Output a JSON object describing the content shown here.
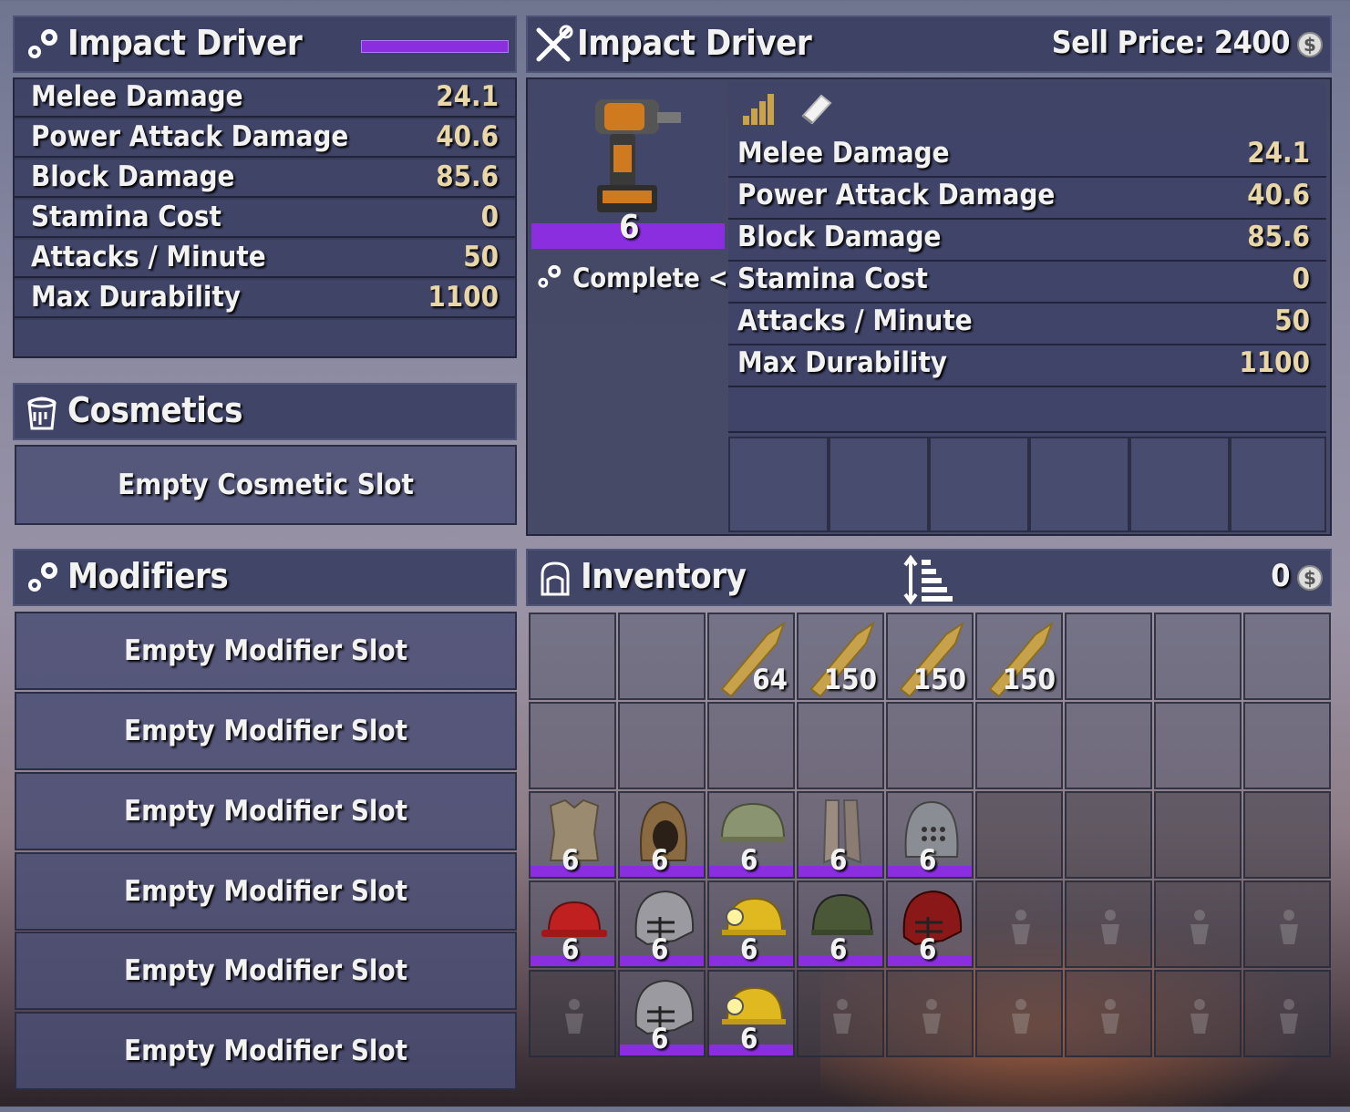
{
  "left_item": {
    "title": "Impact Driver",
    "stats": [
      {
        "label": "Melee Damage",
        "value": "24.1"
      },
      {
        "label": "Power Attack Damage",
        "value": "40.6"
      },
      {
        "label": "Block Damage",
        "value": "85.6"
      },
      {
        "label": "Stamina Cost",
        "value": "0"
      },
      {
        "label": "Attacks / Minute",
        "value": "50"
      },
      {
        "label": "Max Durability",
        "value": "1100"
      }
    ]
  },
  "cosmetics": {
    "title": "Cosmetics",
    "slot": "Empty Cosmetic Slot"
  },
  "modifiers": {
    "title": "Modifiers",
    "slots": [
      "Empty Modifier Slot",
      "Empty Modifier Slot",
      "Empty Modifier Slot",
      "Empty Modifier Slot",
      "Empty Modifier Slot",
      "Empty Modifier Slot"
    ]
  },
  "right_item": {
    "title": "Impact Driver",
    "sell_price": "Sell Price: 2400",
    "item_quality": "6",
    "action": "Complete <W>",
    "stats": [
      {
        "label": "Melee Damage",
        "value": "24.1"
      },
      {
        "label": "Power Attack Damage",
        "value": "40.6"
      },
      {
        "label": "Block Damage",
        "value": "85.6"
      },
      {
        "label": "Stamina Cost",
        "value": "0"
      },
      {
        "label": "Attacks / Minute",
        "value": "50"
      },
      {
        "label": "Max Durability",
        "value": "1100"
      }
    ]
  },
  "inventory": {
    "title": "Inventory",
    "money": "0",
    "row1_counts": [
      "64",
      "150",
      "150",
      "150"
    ],
    "armor_qualities": [
      "6",
      "6",
      "6",
      "6",
      "6",
      "6",
      "6",
      "6",
      "6",
      "6",
      "6",
      "6"
    ]
  },
  "colors": {
    "quality_purple": "#8a2ee0",
    "panel": "#3a3f62"
  },
  "icons": [
    "gears-icon",
    "wrench-screwdriver-icon",
    "coin-icon",
    "paint-bucket-icon",
    "backpack-icon",
    "sort-icon",
    "signal-bars-icon",
    "book-icon",
    "bullet-icon",
    "armor-icon",
    "lock-icon"
  ]
}
